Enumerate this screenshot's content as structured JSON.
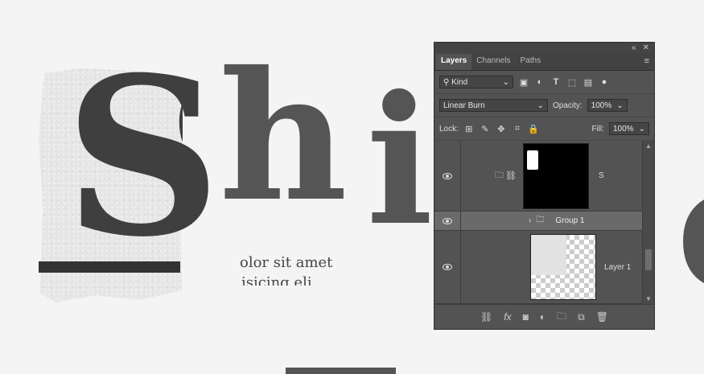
{
  "canvas": {
    "big_letter_s": "S",
    "big_letter_s2": "S",
    "big_letter_h": "h",
    "big_letter_i": "i",
    "big_letter_frag": "e",
    "body_line1": "olor sit amet",
    "body_line2": "isicing eli"
  },
  "panel": {
    "tabs": [
      "Layers",
      "Channels",
      "Paths"
    ],
    "filter": {
      "label": "Kind"
    },
    "blend_mode": "Linear Burn",
    "opacity": {
      "label": "Opacity:",
      "value": "100%"
    },
    "lock": {
      "label": "Lock:"
    },
    "fill": {
      "label": "Fill:",
      "value": "100%"
    },
    "layers": [
      {
        "name": "S"
      },
      {
        "name": "Group 1"
      },
      {
        "name": "Layer 1"
      }
    ],
    "footer_icons": [
      "link-icon",
      "fx-icon",
      "mask-icon",
      "adjustment-icon",
      "folder-icon",
      "new-layer-icon",
      "trash-icon"
    ]
  }
}
